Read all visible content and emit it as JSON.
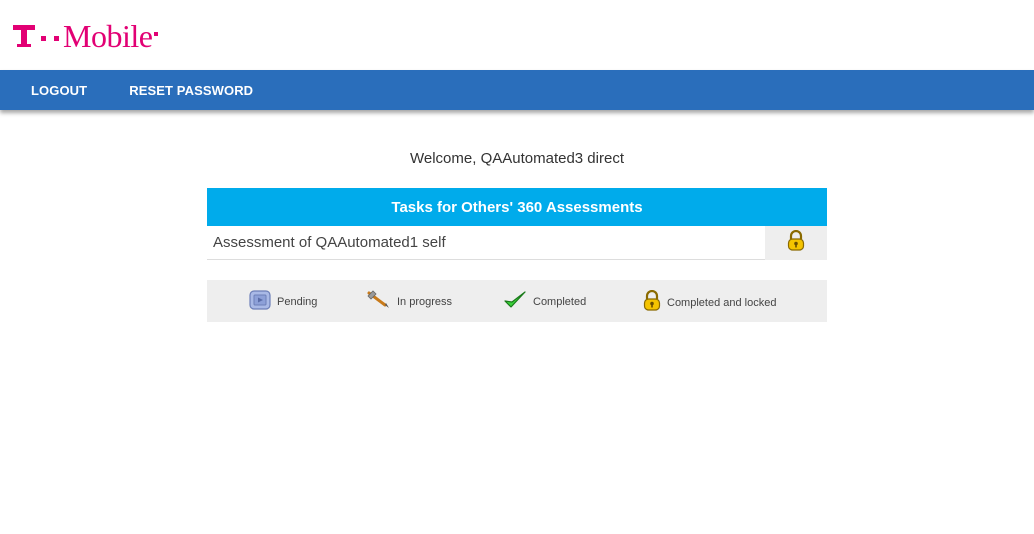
{
  "brand": {
    "wordmark": "Mobile",
    "color": "#e20074"
  },
  "nav": {
    "logout": "LOGOUT",
    "reset_password": "RESET PASSWORD",
    "bar_color": "#2a6ebb"
  },
  "welcome": "Welcome, QAAutomated3 direct",
  "tasks": {
    "header": "Tasks for Others' 360 Assessments",
    "header_color": "#00abeb",
    "rows": [
      {
        "title": "Assessment of QAAutomated1 self",
        "status_icon": "lock-icon"
      }
    ]
  },
  "legend": [
    {
      "icon": "pending-icon",
      "label": "Pending"
    },
    {
      "icon": "pencil-icon",
      "label": "In progress"
    },
    {
      "icon": "checkmark-icon",
      "label": "Completed"
    },
    {
      "icon": "lock-icon",
      "label": "Completed and locked"
    }
  ]
}
